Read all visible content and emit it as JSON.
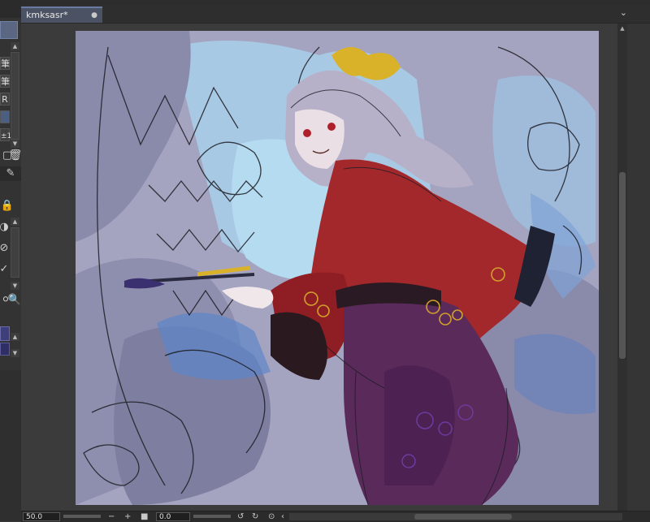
{
  "document": {
    "tab_title": "kmksasr*"
  },
  "left_palette": {
    "labels": [
      "筆",
      "筆",
      "R",
      "±1"
    ]
  },
  "status_bar": {
    "zoom_value": "50.0",
    "rotation_value": "0.0"
  },
  "icons": [
    "trash-icon",
    "lock-icon",
    "pen-icon",
    "search-icon",
    "chevron-down-icon",
    "zoom-out-icon",
    "zoom-in-icon",
    "fit-icon",
    "rotate-left-icon",
    "rotate-right-icon",
    "reset-rotation-icon",
    "flip-icon"
  ],
  "colors": {
    "tab_active": "#4b5263",
    "canvas_sky": "#a9d0ea",
    "canvas_cloud": "#9c9cba",
    "robe_red": "#a3282c",
    "skirt_purple": "#5a2a5a",
    "ribbon_yellow": "#d9b22a"
  }
}
